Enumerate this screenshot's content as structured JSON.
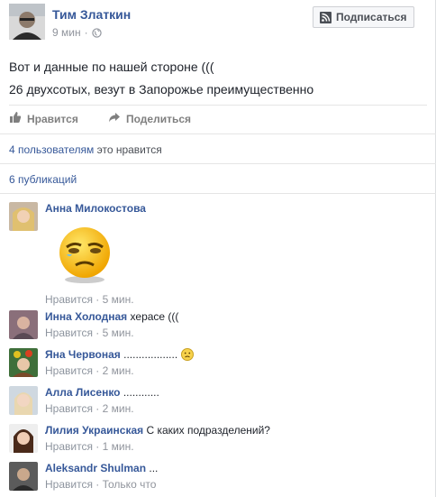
{
  "post": {
    "author": "Тим Златкин",
    "time": "9 мин",
    "dot": "·",
    "subscribe_label": "Подписаться",
    "lines": [
      "Вот и данные по нашей стороне (((",
      "26 двухсотых, везут в Запорожье преимущественно"
    ],
    "actions": {
      "like": "Нравится",
      "share": "Поделиться"
    },
    "likes_count_link": "4 пользователям",
    "likes_suffix": "это нравится",
    "shares": "6 публикаций"
  },
  "icons": {
    "globe": "globe-icon",
    "subscribe": "rss-icon",
    "like": "thumbs-up-icon",
    "share": "share-arrow-icon"
  },
  "colors": {
    "link": "#365899",
    "meta": "#90949c",
    "button_bg": "#f6f7f9"
  },
  "comments": [
    {
      "name": "Анна Милокостова",
      "text": "",
      "like": "Нравится",
      "time": "5 мин.",
      "has_sticker": true
    },
    {
      "name": "Инна Холодная",
      "text": "херасе (((",
      "like": "Нравится",
      "time": "5 мин."
    },
    {
      "name": "Яна Червоная",
      "text": "..................",
      "like": "Нравится",
      "time": "2 мин.",
      "has_emoji": true
    },
    {
      "name": "Алла Лисенко",
      "text": "............",
      "like": "Нравится",
      "time": "2 мин."
    },
    {
      "name": "Лилия Украинская",
      "text": "С каких подразделений?",
      "like": "Нравится",
      "time": "1 мин."
    },
    {
      "name": "Aleksandr Shulman",
      "text": "...",
      "like": "Нравится",
      "time": "Только что"
    }
  ],
  "meta_sep": " · "
}
